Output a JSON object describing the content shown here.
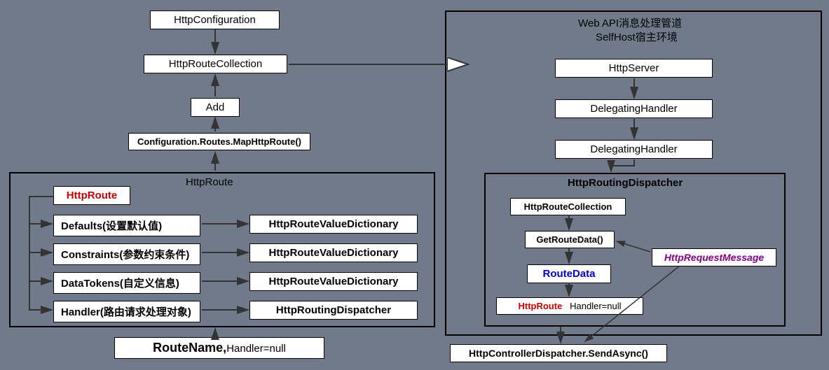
{
  "left": {
    "httpConfiguration": "HttpConfiguration",
    "httpRouteCollection": "HttpRouteCollection",
    "add": "Add",
    "mapRoute": "Configuration.Routes.MapHttpRoute()",
    "httpRouteTitle": "HttpRoute",
    "httpRoute": "HttpRoute",
    "defaults": "Defaults(设置默认值)",
    "constraints": "Constraints(参数约束条件)",
    "dataTokens": "DataTokens(自定义信息)",
    "handler": "Handler(路由请求处理对象)",
    "dict1": "HttpRouteValueDictionary",
    "dict2": "HttpRouteValueDictionary",
    "dict3": "HttpRouteValueDictionary",
    "routingDispatcher": "HttpRoutingDispatcher",
    "routeName": "RouteName,",
    "handlerNull": "Handler=null"
  },
  "right": {
    "title1": "Web API消息处理管道",
    "title2": "SelfHost宿主环境",
    "httpServer": "HttpServer",
    "delegating1": "DelegatingHandler",
    "delegating2": "DelegatingHandler",
    "dispatcherTitle": "HttpRoutingDispatcher",
    "routeCollection": "HttpRouteCollection",
    "getRouteData": "GetRouteData()",
    "routeData": "RouteData",
    "httpRoute": "HttpRoute",
    "handlerNull": "Handler=null",
    "requestMessage": "HttpRequestMessage",
    "controllerDispatcher": "HttpControllerDispatcher.SendAsync()"
  }
}
